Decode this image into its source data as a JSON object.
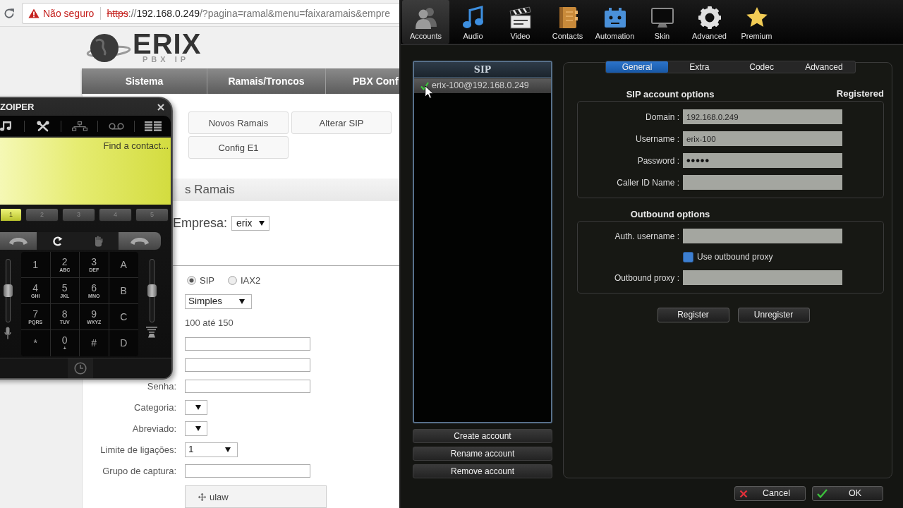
{
  "browser": {
    "security_label": "Não seguro",
    "url": [
      {
        "kind": "insecure-scheme",
        "text": "https"
      },
      {
        "kind": "muted",
        "text": "://"
      },
      {
        "kind": "host",
        "text": "192.168.0.249"
      },
      {
        "kind": "muted",
        "text": "/?pagina=ramal&menu=faixaramais&empre"
      }
    ]
  },
  "site": {
    "logo": {
      "name": "ERIX",
      "tagline": "PBX IP"
    },
    "main_menu": [
      "Sistema",
      "Ramais/Troncos",
      "PBX Conf"
    ],
    "sub_menu_rows": [
      [
        "Novos Ramais",
        "Alterar SIP"
      ],
      [
        "Config E1"
      ]
    ],
    "page_title": "s Ramais",
    "company": {
      "label": "Empresa:",
      "value": "erix"
    },
    "form": [
      {
        "kind": "radio",
        "options": [
          {
            "label": "SIP",
            "selected": true
          },
          {
            "label": "IAX2",
            "selected": false
          }
        ]
      },
      {
        "kind": "select",
        "value": "Simples"
      },
      {
        "kind": "text",
        "value": "100 até 150"
      },
      {
        "kind": "input"
      },
      {
        "kind": "input"
      },
      {
        "kind": "input",
        "label": "Senha:"
      },
      {
        "kind": "select",
        "label": "Categoria:"
      },
      {
        "kind": "select",
        "label": "Abreviado:"
      },
      {
        "kind": "select",
        "label": "Limite de ligações:",
        "value": "1"
      },
      {
        "kind": "input",
        "label": "Grupo de captura:"
      },
      {
        "kind": "codec-list",
        "items": [
          "ulaw"
        ]
      }
    ]
  },
  "phone": {
    "title": "ZOIPER",
    "search_placeholder": "Find a contact...",
    "lines": [
      {
        "label": "1",
        "selected": true
      },
      {
        "label": "2",
        "selected": false
      },
      {
        "label": "3",
        "selected": false
      },
      {
        "label": "4",
        "selected": false
      },
      {
        "label": "5",
        "selected": false
      }
    ],
    "keys": [
      {
        "digit": "1"
      },
      {
        "digit": "2",
        "letters": "ABC"
      },
      {
        "digit": "3",
        "letters": "DEF"
      },
      {
        "digit": "A"
      },
      {
        "digit": "4",
        "letters": "GHI"
      },
      {
        "digit": "5",
        "letters": "JKL"
      },
      {
        "digit": "6",
        "letters": "MNO"
      },
      {
        "digit": "B"
      },
      {
        "digit": "7",
        "letters": "PQRS"
      },
      {
        "digit": "8",
        "letters": "TUV"
      },
      {
        "digit": "9",
        "letters": "WXYZ"
      },
      {
        "digit": "C"
      },
      {
        "digit": "*"
      },
      {
        "digit": "0",
        "letters": "+"
      },
      {
        "digit": "#"
      },
      {
        "digit": "D"
      }
    ],
    "mic": {
      "level": 0.5
    },
    "speaker": {
      "level": 0.5
    }
  },
  "settings": {
    "toolbar": [
      {
        "label": "Accounts",
        "selected": true
      },
      {
        "label": "Audio",
        "selected": false
      },
      {
        "label": "Video",
        "selected": false
      },
      {
        "label": "Contacts",
        "selected": false
      },
      {
        "label": "Automation",
        "selected": false
      },
      {
        "label": "Skin",
        "selected": false
      },
      {
        "label": "Advanced",
        "selected": false
      },
      {
        "label": "Premium",
        "selected": false
      }
    ],
    "accounts": {
      "header": "SIP",
      "items": [
        {
          "label": "erix-100@192.168.0.249",
          "selected": true,
          "registered": true
        }
      ]
    },
    "account_buttons": [
      "Create account",
      "Rename account",
      "Remove account"
    ],
    "tabs": [
      {
        "label": "General",
        "selected": true
      },
      {
        "label": "Extra",
        "selected": false
      },
      {
        "label": "Codec",
        "selected": false
      },
      {
        "label": "Advanced",
        "selected": false
      }
    ],
    "sections": [
      {
        "title": "SIP account options",
        "status": "Registered",
        "rows": [
          {
            "kind": "field",
            "label": "Domain :",
            "value": "192.168.0.249"
          },
          {
            "kind": "field",
            "label": "Username :",
            "value": "erix-100"
          },
          {
            "kind": "password",
            "label": "Password :",
            "value": "•••••"
          },
          {
            "kind": "field",
            "label": "Caller ID Name :"
          }
        ]
      },
      {
        "title": "Outbound options",
        "rows": [
          {
            "kind": "field",
            "label": "Auth. username :"
          },
          {
            "kind": "checkbox",
            "label": "Use outbound proxy",
            "checked": false
          },
          {
            "kind": "field",
            "label": "Outbound proxy :"
          }
        ]
      }
    ],
    "actions": [
      "Register",
      "Unregister"
    ],
    "dialog_buttons": [
      {
        "kind": "cancel",
        "label": "Cancel"
      },
      {
        "kind": "ok",
        "label": "OK"
      }
    ]
  }
}
